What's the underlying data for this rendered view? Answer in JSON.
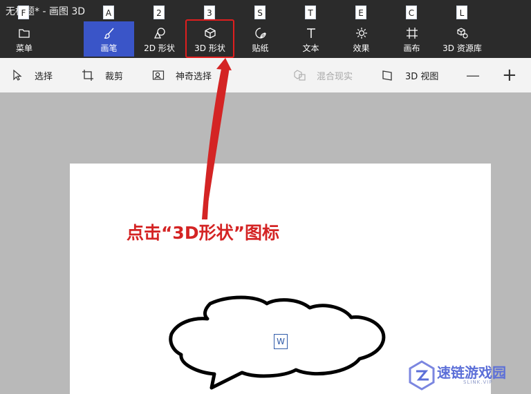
{
  "window": {
    "title": "无标题* - 画图 3D"
  },
  "hotkeys": [
    "F",
    "A",
    "2",
    "3",
    "S",
    "T",
    "E",
    "C",
    "L"
  ],
  "menu": {
    "label": "菜单",
    "icon": "folder-icon"
  },
  "tabs": [
    {
      "label": "画笔",
      "icon": "brush-icon",
      "active": true
    },
    {
      "label": "2D 形状",
      "icon": "2d-shapes-icon"
    },
    {
      "label": "3D 形状",
      "icon": "cube-icon",
      "highlighted": true
    },
    {
      "label": "贴纸",
      "icon": "sticker-icon"
    },
    {
      "label": "文本",
      "icon": "text-icon"
    },
    {
      "label": "效果",
      "icon": "sun-icon"
    },
    {
      "label": "画布",
      "icon": "canvas-icon"
    },
    {
      "label": "3D 资源库",
      "icon": "3d-library-icon"
    }
  ],
  "toolbar": {
    "select": "选择",
    "crop": "裁剪",
    "magic_select": "神奇选择",
    "mixed_reality": "混合现实",
    "view_3d": "3D 视图",
    "zoom_out": "—",
    "zoom_in": "+"
  },
  "annotation": {
    "text": "点击“3D形状”图标",
    "color": "#d42424"
  },
  "canvas": {
    "text_marker": "W"
  },
  "watermark": {
    "text": "速链游戏园",
    "sub": "SLINK.VIP"
  },
  "colors": {
    "accent": "#3a55c8",
    "highlight": "#e01e1e",
    "titlebar": "#2b2b2b"
  }
}
